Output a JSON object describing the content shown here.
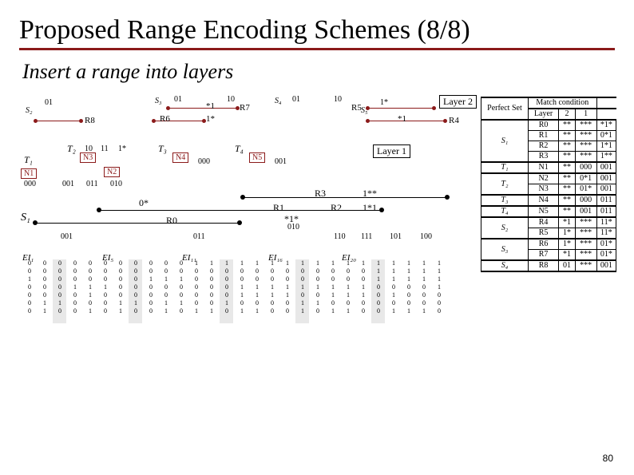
{
  "title": "Proposed Range Encoding Schemes (8/8)",
  "subtitle": "Insert a range into layers",
  "page_number": "80",
  "layer_labels": {
    "layer2": "Layer 2",
    "layer1": "Layer 1"
  },
  "layer2": {
    "S2": {
      "label": "S₂",
      "code": "01",
      "R8": {
        "label": "R8"
      }
    },
    "S3": {
      "label": "S₃",
      "codes": [
        "01",
        "10"
      ],
      "R6": {
        "label": "R6",
        "code": "1*"
      },
      "R7": {
        "label": "R7",
        "code": "*1"
      }
    },
    "S4": {
      "label": "S₄",
      "codes": [
        "01",
        "10"
      ]
    },
    "S5": {
      "label": "S₅",
      "code": "1*",
      "R4": {
        "label": "R4",
        "code": "*1"
      },
      "R5": {
        "label": "R5"
      }
    }
  },
  "layer1": {
    "T1": {
      "label": "T₁",
      "N1": {
        "label": "N1",
        "code": "000"
      }
    },
    "T2": {
      "label": "T₂",
      "codes": [
        "10",
        "11",
        "1*"
      ],
      "N2": {
        "label": "N2"
      },
      "N3": {
        "label": "N3"
      }
    },
    "T3": {
      "label": "T₃",
      "N4": {
        "label": "N4",
        "code": "000"
      }
    },
    "T4": {
      "label": "T₄",
      "N5": {
        "label": "N5",
        "code": "001"
      }
    },
    "row_codes": [
      "001",
      "011",
      "010"
    ]
  },
  "s1": {
    "label": "S₁",
    "R0": {
      "label": "R0",
      "code": "0*"
    },
    "R1": {
      "label": "R1",
      "code": "*1*"
    },
    "R2": {
      "label": "R2",
      "code": "1*1"
    },
    "R3": {
      "label": "R3",
      "code": "1**"
    },
    "row_codes": [
      "001",
      "011",
      "010",
      "110",
      "111",
      "101",
      "100"
    ]
  },
  "ei": [
    "EI₁",
    "EI₅",
    "EI₁₁",
    "EI₁₆",
    "EI₂₀"
  ],
  "bit_matrix_header": [
    "0",
    "0",
    "0",
    "0",
    "0",
    "0",
    "0",
    "0",
    "0",
    "0",
    "0",
    "1",
    "1",
    "1",
    "1",
    "1",
    "1",
    "1",
    "1",
    "1",
    "1",
    "1",
    "1",
    "1",
    "1",
    "1",
    "1",
    "1"
  ],
  "bit_rows": [
    [
      "0",
      "0",
      "0",
      "0",
      "0",
      "0",
      "0",
      "0",
      "0",
      "0",
      "0",
      "0",
      "0",
      "0",
      "0",
      "0",
      "0",
      "0",
      "0",
      "0",
      "0",
      "0",
      "0",
      "1",
      "1",
      "1",
      "1",
      "1"
    ],
    [
      "1",
      "0",
      "0",
      "0",
      "0",
      "0",
      "0",
      "0",
      "1",
      "1",
      "1",
      "0",
      "0",
      "0",
      "0",
      "0",
      "0",
      "0",
      "0",
      "0",
      "0",
      "0",
      "0",
      "1",
      "1",
      "1",
      "1",
      "1"
    ],
    [
      "0",
      "0",
      "0",
      "1",
      "1",
      "1",
      "0",
      "0",
      "0",
      "0",
      "0",
      "0",
      "0",
      "0",
      "1",
      "1",
      "1",
      "1",
      "1",
      "1",
      "1",
      "1",
      "1",
      "0",
      "0",
      "0",
      "0",
      "1"
    ],
    [
      "0",
      "0",
      "0",
      "0",
      "1",
      "0",
      "0",
      "0",
      "0",
      "0",
      "0",
      "0",
      "0",
      "0",
      "1",
      "1",
      "1",
      "1",
      "0",
      "0",
      "1",
      "1",
      "1",
      "0",
      "1",
      "0",
      "0",
      "0"
    ],
    [
      "0",
      "1",
      "1",
      "0",
      "0",
      "0",
      "1",
      "1",
      "0",
      "1",
      "1",
      "0",
      "0",
      "1",
      "0",
      "0",
      "0",
      "0",
      "1",
      "1",
      "0",
      "0",
      "0",
      "0",
      "0",
      "0",
      "0",
      "0"
    ],
    [
      "0",
      "1",
      "0",
      "0",
      "1",
      "0",
      "1",
      "0",
      "0",
      "1",
      "0",
      "1",
      "1",
      "0",
      "1",
      "1",
      "0",
      "0",
      "1",
      "0",
      "1",
      "1",
      "0",
      "0",
      "1",
      "1",
      "1",
      "0"
    ]
  ],
  "table": {
    "header1": "Perfect Set",
    "header2": "Match condition",
    "header3": "Layer",
    "cols": [
      "2",
      "1"
    ],
    "groups": [
      {
        "set": "S₁",
        "rows": [
          {
            "r": "R0",
            "v": [
              "**",
              "***",
              "*1*"
            ]
          },
          {
            "r": "R1",
            "v": [
              "**",
              "***",
              "0*1"
            ]
          },
          {
            "r": "R2",
            "v": [
              "**",
              "***",
              "1*1"
            ]
          },
          {
            "r": "R3",
            "v": [
              "**",
              "***",
              "1**"
            ]
          }
        ]
      },
      {
        "set": "T₁",
        "rows": [
          {
            "r": "N1",
            "v": [
              "**",
              "000",
              "001"
            ]
          }
        ]
      },
      {
        "set": "T₂",
        "rows": [
          {
            "r": "N2",
            "v": [
              "**",
              "0*1",
              "001"
            ]
          },
          {
            "r": "N3",
            "v": [
              "**",
              "01*",
              "001"
            ]
          }
        ]
      },
      {
        "set": "T₃",
        "rows": [
          {
            "r": "N4",
            "v": [
              "**",
              "000",
              "011"
            ]
          }
        ]
      },
      {
        "set": "T₄",
        "rows": [
          {
            "r": "N5",
            "v": [
              "**",
              "001",
              "011"
            ]
          }
        ]
      },
      {
        "set": "S₂",
        "rows": [
          {
            "r": "R4",
            "v": [
              "*1",
              "***",
              "11*"
            ]
          },
          {
            "r": "R5",
            "v": [
              "1*",
              "***",
              "11*"
            ]
          }
        ]
      },
      {
        "set": "S₃",
        "rows": [
          {
            "r": "R6",
            "v": [
              "1*",
              "***",
              "01*"
            ]
          },
          {
            "r": "R7",
            "v": [
              "*1",
              "***",
              "01*"
            ]
          }
        ]
      },
      {
        "set": "S₄",
        "rows": [
          {
            "r": "R8",
            "v": [
              "01",
              "***",
              "001"
            ]
          }
        ]
      }
    ]
  }
}
